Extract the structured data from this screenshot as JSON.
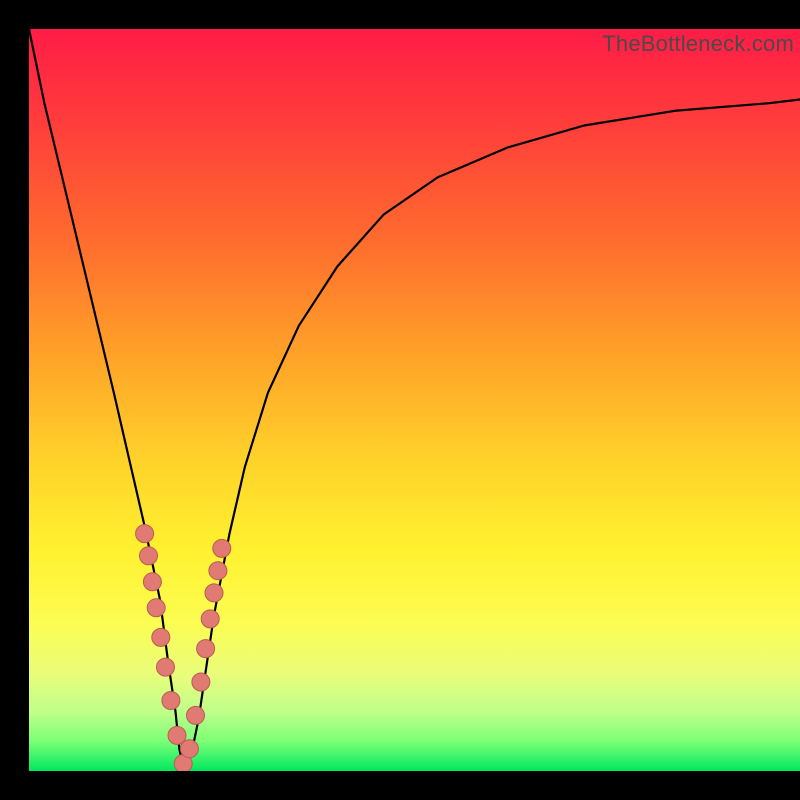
{
  "watermark": "TheBottleneck.com",
  "colors": {
    "frame": "#000000",
    "gradient_top": "#ff1c47",
    "gradient_bottom": "#00e85f",
    "curve": "#000000",
    "marker_fill": "#e07a72",
    "marker_stroke": "#b85b55"
  },
  "chart_data": {
    "type": "line",
    "title": "",
    "xlabel": "",
    "ylabel": "",
    "xlim": [
      0,
      100
    ],
    "ylim": [
      0,
      100
    ],
    "grid": false,
    "legend": false,
    "series": [
      {
        "name": "bottleneck-curve",
        "x": [
          0,
          2,
          5,
          8,
          11,
          13,
          15,
          17,
          18,
          19,
          19.5,
          20,
          21,
          22,
          23,
          24,
          26,
          28,
          31,
          35,
          40,
          46,
          53,
          62,
          72,
          84,
          96,
          100
        ],
        "values": [
          100,
          90,
          77,
          64,
          51,
          42,
          33,
          23,
          15,
          8,
          3,
          0.5,
          2,
          7,
          14,
          21,
          32,
          41,
          51,
          60,
          68,
          75,
          80,
          84,
          87,
          89,
          90,
          90.5
        ]
      }
    ],
    "markers": {
      "name": "highlighted-points",
      "x": [
        15.0,
        15.5,
        16.0,
        16.5,
        17.1,
        17.7,
        18.4,
        19.2,
        20.0,
        20.8,
        21.6,
        22.3,
        22.9,
        23.5,
        24.0,
        24.5,
        25.0
      ],
      "values": [
        32.0,
        29.0,
        25.5,
        22.0,
        18.0,
        14.0,
        9.5,
        4.8,
        1.0,
        3.0,
        7.5,
        12.0,
        16.5,
        20.5,
        24.0,
        27.0,
        30.0
      ]
    },
    "annotations": [
      {
        "text": "TheBottleneck.com",
        "position": "top-right"
      }
    ]
  }
}
